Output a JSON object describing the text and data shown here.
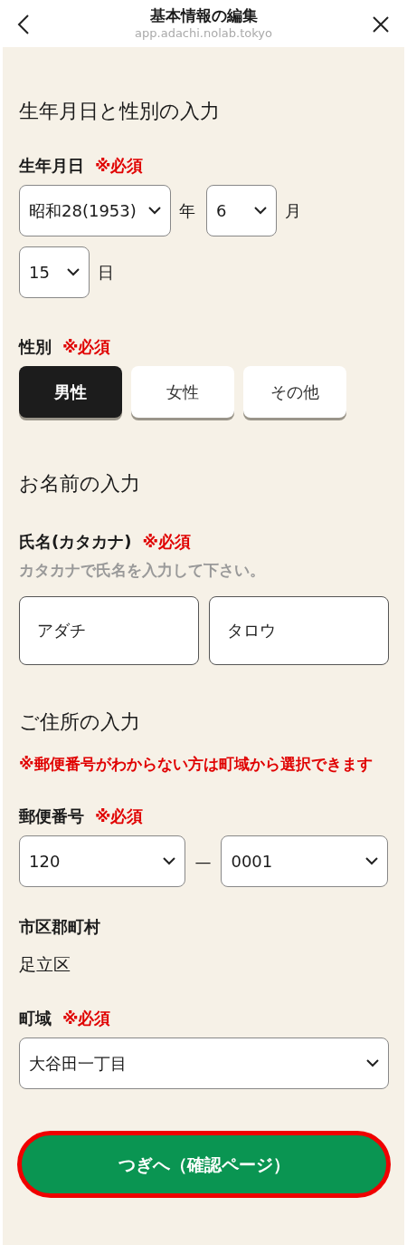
{
  "header": {
    "title": "基本情報の編集",
    "url": "app.adachi.nolab.tokyo"
  },
  "birth_section": {
    "heading": "生年月日と性別の入力",
    "birthdate": {
      "label": "生年月日",
      "required": "※必須",
      "selects": [
        {
          "value": "昭和28(1953)",
          "unit": "年"
        },
        {
          "value": "6",
          "unit": "月"
        },
        {
          "value": "15",
          "unit": "日"
        }
      ]
    },
    "gender": {
      "label": "性別",
      "required": "※必須",
      "options": [
        {
          "label": "男性",
          "selected": true
        },
        {
          "label": "女性",
          "selected": false
        },
        {
          "label": "その他",
          "selected": false
        }
      ]
    }
  },
  "name_section": {
    "heading": "お名前の入力",
    "label": "氏名(カタカナ)",
    "required": "※必須",
    "hint": "カタカナで氏名を入力して下さい。",
    "inputs": [
      {
        "value": "アダチ"
      },
      {
        "value": "タロウ"
      }
    ]
  },
  "address_section": {
    "heading": "ご住所の入力",
    "note": "※郵便番号がわからない方は町域から選択できます",
    "postal": {
      "label": "郵便番号",
      "required": "※必須",
      "first": "120",
      "separator": "—",
      "second": "0001"
    },
    "city": {
      "label": "市区郡町村",
      "value": "足立区"
    },
    "town": {
      "label": "町域",
      "required": "※必須",
      "value": "大谷田一丁目"
    }
  },
  "submit_button": "つぎへ（確認ページ）"
}
